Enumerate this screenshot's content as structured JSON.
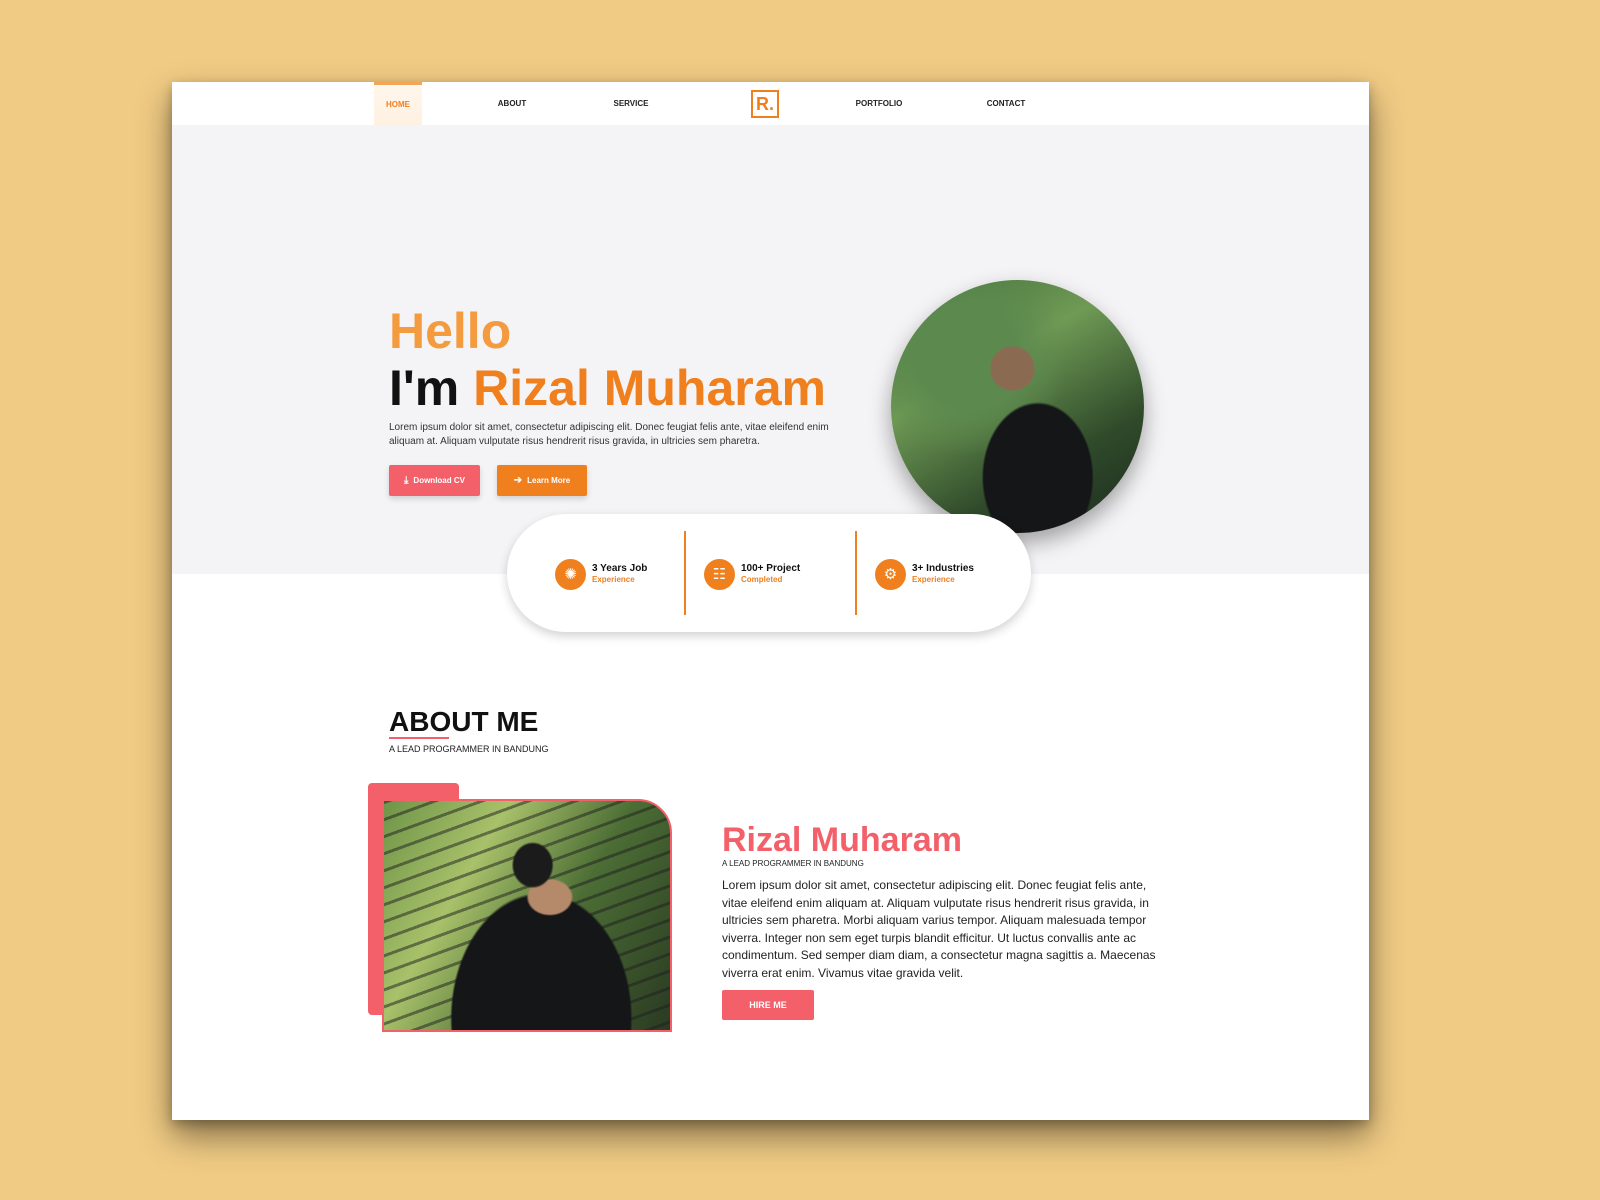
{
  "nav": {
    "items": [
      {
        "label": "HOME",
        "active": true
      },
      {
        "label": "ABOUT",
        "active": false
      },
      {
        "label": "SERVICE",
        "active": false
      },
      {
        "label": "PORTFOLIO",
        "active": false
      },
      {
        "label": "CONTACT",
        "active": false
      }
    ],
    "logo_text": "R."
  },
  "hero": {
    "greeting": "Hello",
    "intro_prefix": "I'm ",
    "name": "Rizal Muharam",
    "description": "Lorem ipsum dolor sit amet, consectetur adipiscing elit. Donec feugiat felis ante, vitae eleifend enim aliquam at. Aliquam vulputate risus hendrerit risus gravida, in ultricies sem pharetra.",
    "download_label": "Download CV",
    "learn_label": "Learn More",
    "download_icon": "download-icon",
    "learn_icon": "arrow-right-icon"
  },
  "stats": [
    {
      "title": "3 Years Job",
      "subtitle": "Experience",
      "icon": "experience-icon"
    },
    {
      "title": "100+ Project",
      "subtitle": "Completed",
      "icon": "project-icon"
    },
    {
      "title": "3+ Industries",
      "subtitle": "Experience",
      "icon": "industries-icon"
    }
  ],
  "about": {
    "title": "ABOUT ME",
    "subtitle": "A LEAD PROGRAMMER IN BANDUNG",
    "name": "Rizal Muharam",
    "role": "A LEAD PROGRAMMER IN BANDUNG",
    "description": "Lorem ipsum dolor sit amet, consectetur adipiscing elit. Donec feugiat felis ante, vitae eleifend enim aliquam at. Aliquam vulputate risus hendrerit risus gravida, in ultricies sem pharetra. Morbi aliquam varius tempor. Aliquam malesuada tempor viverra. Integer non sem eget turpis blandit efficitur. Ut luctus convallis ante ac condimentum. Sed semper diam diam, a consectetur magna sagittis a. Maecenas viverra erat enim. Vivamus vitae gravida velit.",
    "hire_label": "HIRE ME"
  },
  "colors": {
    "background": "#f0cb84",
    "accent_orange": "#f07f1e",
    "accent_coral": "#f3606a",
    "hero_bg": "#f4f4f6"
  }
}
